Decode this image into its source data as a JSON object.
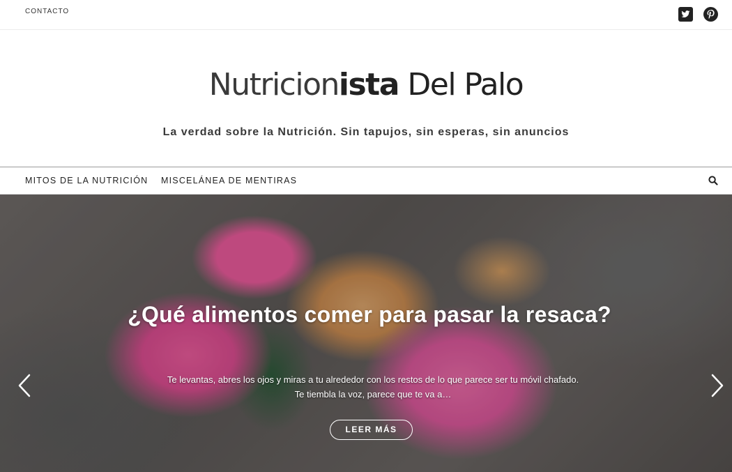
{
  "topbar": {
    "contact_label": "CONTACTO",
    "social": [
      "twitter-icon",
      "pinterest-icon"
    ]
  },
  "header": {
    "logo_part1": "Nutricion",
    "logo_part2": "ista",
    "logo_part3": " Del Palo",
    "tagline": "La verdad sobre la Nutrición. Sin tapujos, sin esperas, sin anuncios"
  },
  "nav": {
    "items": [
      {
        "label": "MITOS DE LA NUTRICIÓN"
      },
      {
        "label": "MISCELÁNEA DE MENTIRAS"
      }
    ],
    "search_icon": "search-icon"
  },
  "hero": {
    "title": "¿Qué alimentos comer para pasar la resaca?",
    "excerpt_line1": "Te levantas, abres los ojos y miras a tu alrededor con los restos de lo que parece ser tu móvil chafado.",
    "excerpt_line2": "Te tiembla la voz, parece que te va a…",
    "button_label": "LEER MÁS",
    "prev_icon": "chevron-left-icon",
    "next_icon": "chevron-right-icon"
  },
  "colors": {
    "text_dark": "#222222",
    "border": "#ececec",
    "hero_text": "#ffffff"
  }
}
